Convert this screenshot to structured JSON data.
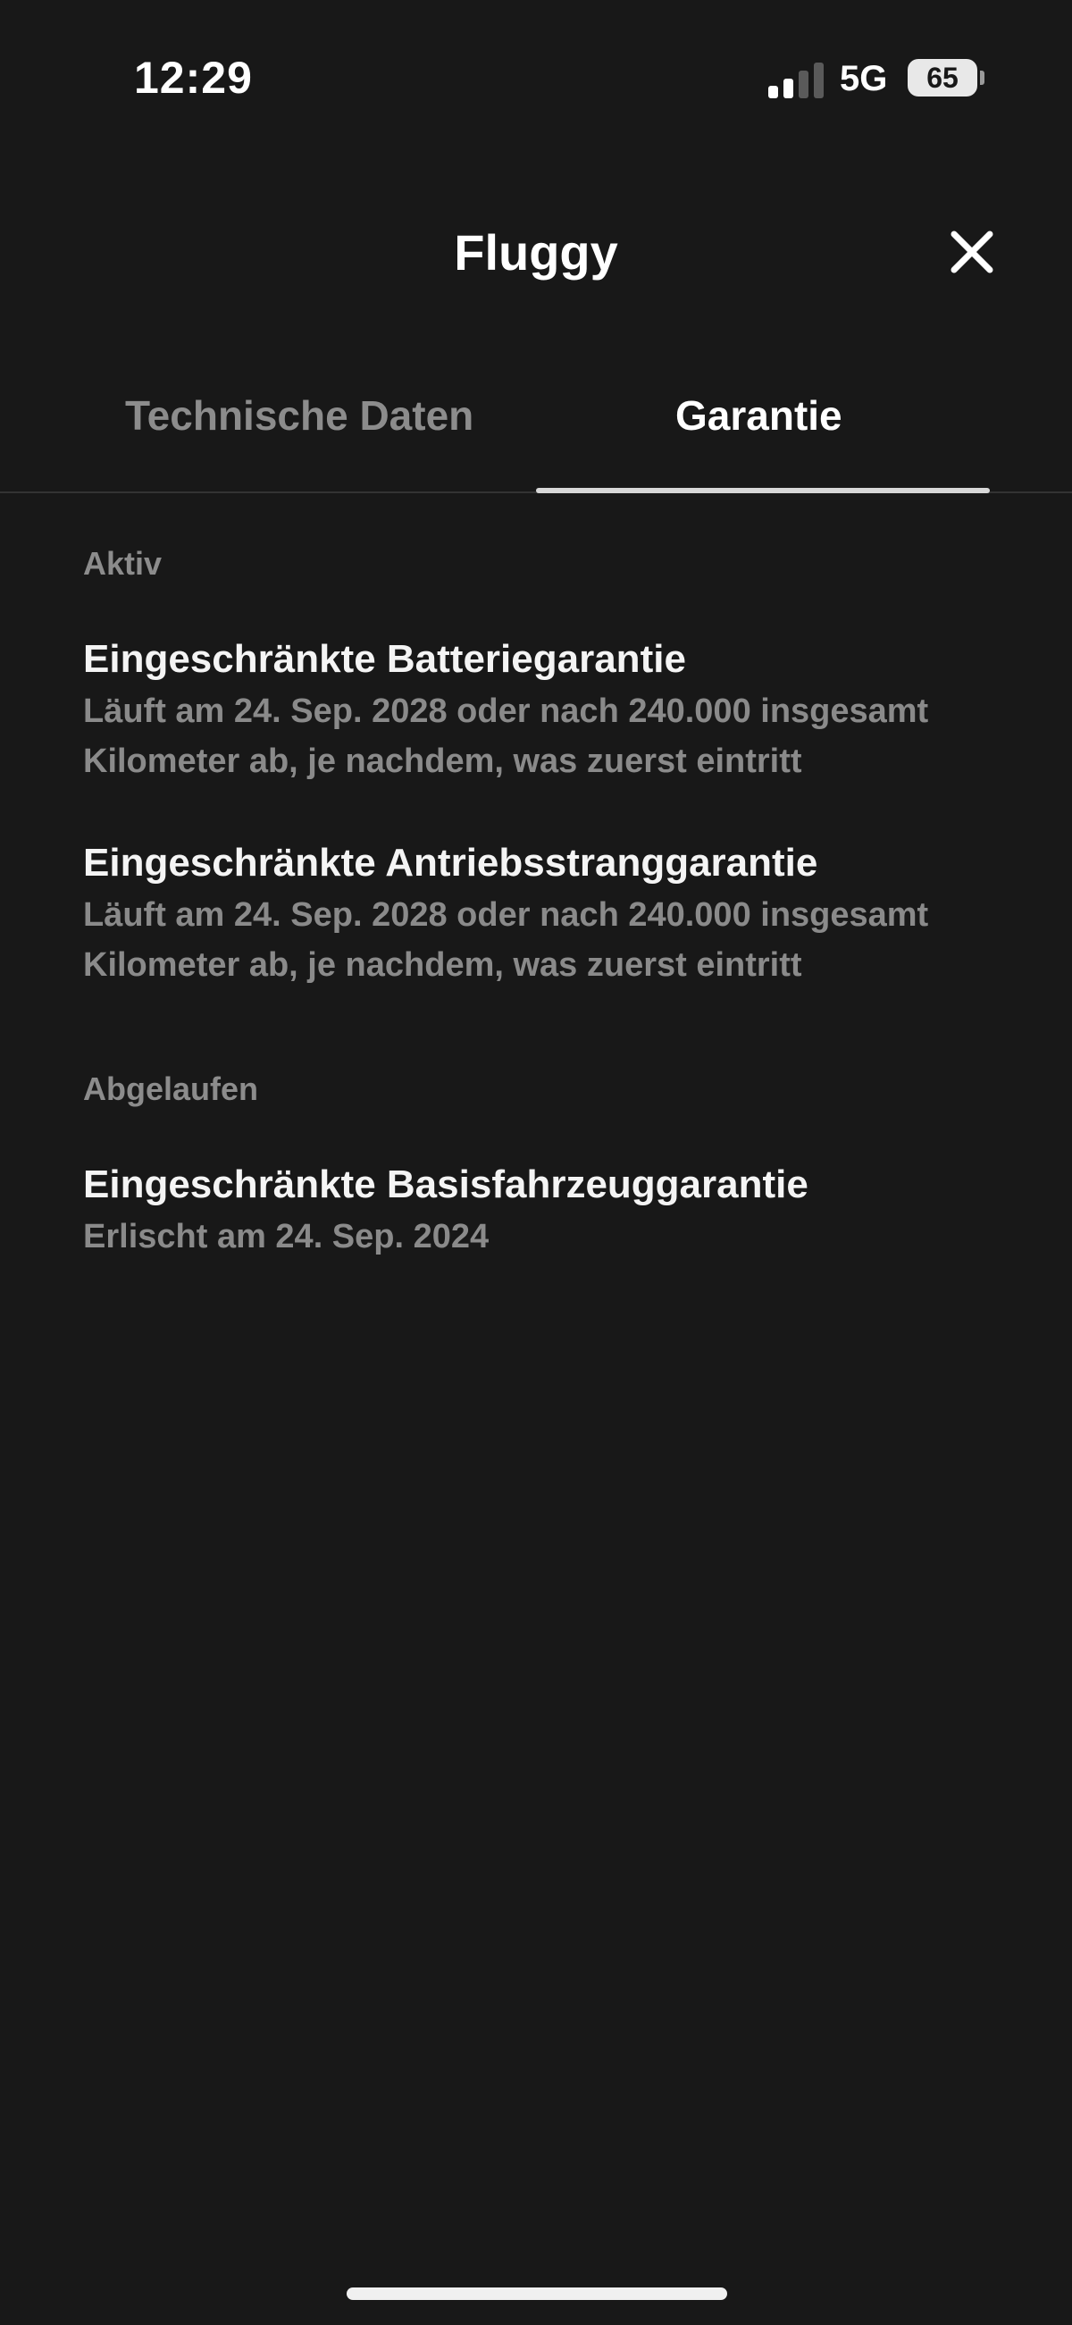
{
  "status_bar": {
    "time": "12:29",
    "network": "5G",
    "battery": "65"
  },
  "header": {
    "title": "Fluggy",
    "close_icon": "close-icon"
  },
  "tabs": [
    {
      "label": "Technische Daten",
      "active": false
    },
    {
      "label": "Garantie",
      "active": true
    }
  ],
  "sections": {
    "active": {
      "label": "Aktiv",
      "items": [
        {
          "title": "Eingeschränkte Batteriegarantie",
          "description": "Läuft am 24. Sep. 2028 oder nach 240.000 insgesamt Kilometer ab, je nachdem, was zuerst eintritt"
        },
        {
          "title": "Eingeschränkte Antriebsstranggarantie",
          "description": "Läuft am 24. Sep. 2028 oder nach 240.000 insgesamt Kilometer ab, je nachdem, was zuerst eintritt"
        }
      ]
    },
    "expired": {
      "label": "Abgelaufen",
      "items": [
        {
          "title": "Eingeschränkte Basisfahrzeuggarantie",
          "description": "Erlischt am 24. Sep. 2024"
        }
      ]
    }
  },
  "colors": {
    "background": "#181818",
    "text_primary": "#f4f4f4",
    "text_secondary": "#8a8a8a",
    "tab_underline": "#d8d8d8"
  }
}
